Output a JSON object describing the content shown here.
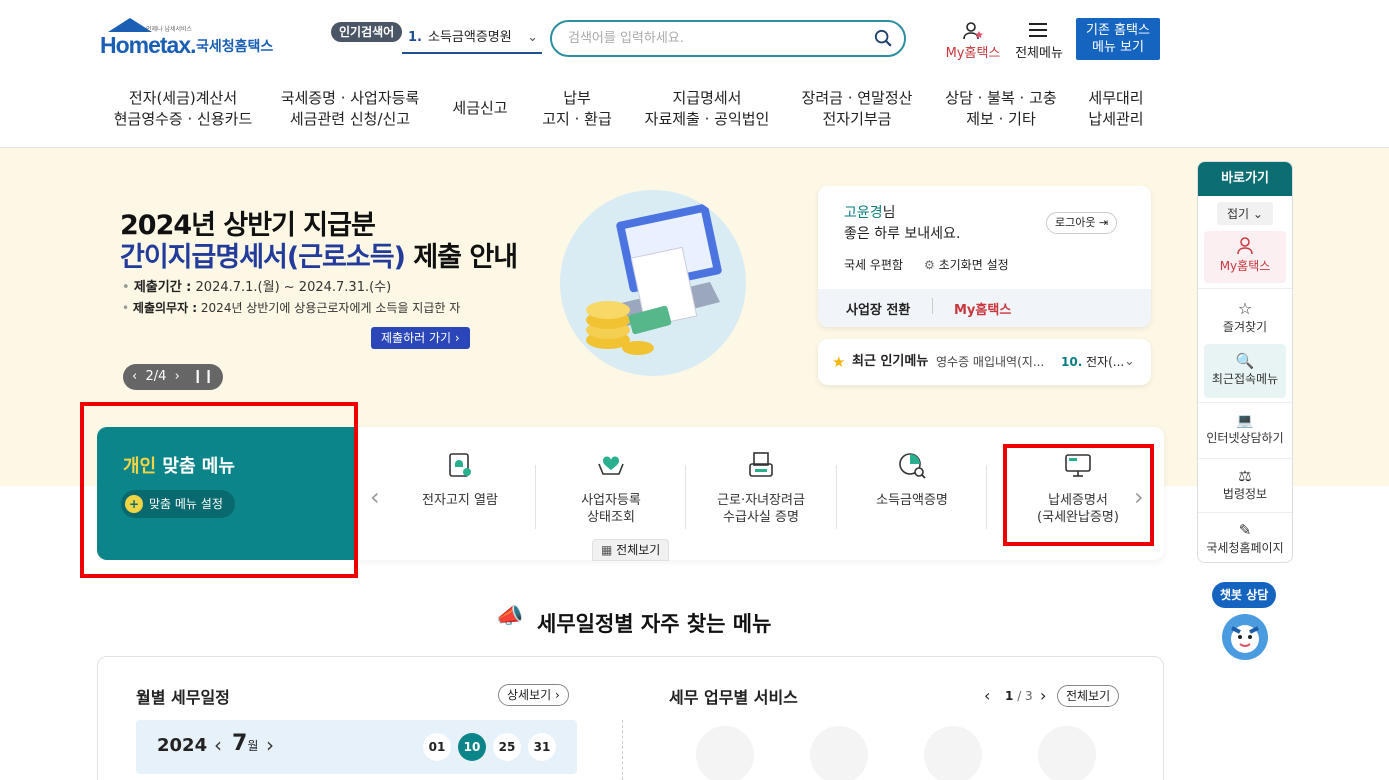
{
  "header": {
    "logo_tagline": "언제나 납세서비스",
    "logo_en": "Hometax.",
    "logo_kr": "국세청홈택스",
    "popular_label": "인기검색어",
    "popular_rank": "1.",
    "popular_term": "소득금액증명원",
    "search_placeholder": "검색어를 입력하세요.",
    "my_hometax": "My홈택스",
    "all_menu": "전체메뉴",
    "old_site_line1": "기존 홈택스",
    "old_site_line2": "메뉴 보기"
  },
  "nav": [
    {
      "line1": "전자(세금)계산서",
      "line2": "현금영수증 · 신용카드"
    },
    {
      "line1": "국세증명 · 사업자등록",
      "line2": "세금관련 신청/신고"
    },
    {
      "line1": "세금신고",
      "line2": ""
    },
    {
      "line1": "납부",
      "line2": "고지 · 환급"
    },
    {
      "line1": "지급명세서",
      "line2": "자료제출 · 공익법인"
    },
    {
      "line1": "장려금 · 연말정산",
      "line2": "전자기부금"
    },
    {
      "line1": "상담 · 불복 · 고충",
      "line2": "제보 · 기타"
    },
    {
      "line1": "세무대리",
      "line2": "납세관리"
    }
  ],
  "banner": {
    "title1": "2024년 상반기 지급분",
    "title2_highlight": "간이지급명세서(근로소득)",
    "title2_rest": " 제출 안내",
    "period_label": "제출기간 :",
    "period_value": " 2024.7.1.(월) ~ 2024.7.31.(수)",
    "duty_label": "제출의무자 :",
    "duty_value": " 2024년 상반기에 상용근로자에게 소득을 지급한 자",
    "cta": "제출하러 가기",
    "pager": "2/4"
  },
  "user_card": {
    "name": "고윤경",
    "honorific": "님",
    "greeting": "좋은 하루 보내세요.",
    "logout": "로그아웃",
    "mailbox": "국세 우편함",
    "init_setting": "초기화면 설정",
    "switch_biz": "사업장 전환",
    "my_hometax": "My홈택스"
  },
  "popular_menu": {
    "label": "최근 인기메뉴",
    "item1": "영수증 매입내역(지...",
    "rank2": "10.",
    "item2": "전자(..."
  },
  "custom_menu": {
    "title_highlight": "개인",
    "title_rest": " 맞춤 메뉴",
    "setting": "맞춤 메뉴 설정"
  },
  "quick_menu": {
    "items": [
      {
        "line1": "전자고지 열람",
        "line2": "",
        "icon": "document-bell-icon"
      },
      {
        "line1": "사업자등록",
        "line2": "상태조회",
        "icon": "heart-hands-icon"
      },
      {
        "line1": "근로·자녀장려금",
        "line2": "수급사실 증명",
        "icon": "printer-doc-icon"
      },
      {
        "line1": "소득금액증명",
        "line2": "",
        "icon": "pie-magnifier-icon"
      },
      {
        "line1": "납세증명서",
        "line2": "(국세완납증명)",
        "icon": "monitor-icon"
      }
    ],
    "view_all": "전체보기"
  },
  "sidebar": {
    "title": "바로가기",
    "fold": "접기",
    "items": [
      "My홈택스",
      "즐겨찾기",
      "최근접속메뉴",
      "인터넷상담하기",
      "법령정보",
      "국세청홈페이지"
    ],
    "chatbot": "챗봇 상담"
  },
  "schedule": {
    "section_title": "세무일정별 자주 찾는 메뉴",
    "monthly_title": "월별 세무일정",
    "detail": "상세보기",
    "year": "2024",
    "month": "7",
    "month_unit": "월",
    "days": [
      "01",
      "10",
      "25",
      "31"
    ],
    "service_title": "세무 업무별 서비스",
    "page_current": "1",
    "page_total": "/ 3",
    "view_all": "전체보기"
  },
  "colors": {
    "teal": "#0b8589",
    "brand_blue": "#1565c0",
    "highlight_red": "#e00000",
    "banner_bg": "#fdf7e5"
  }
}
